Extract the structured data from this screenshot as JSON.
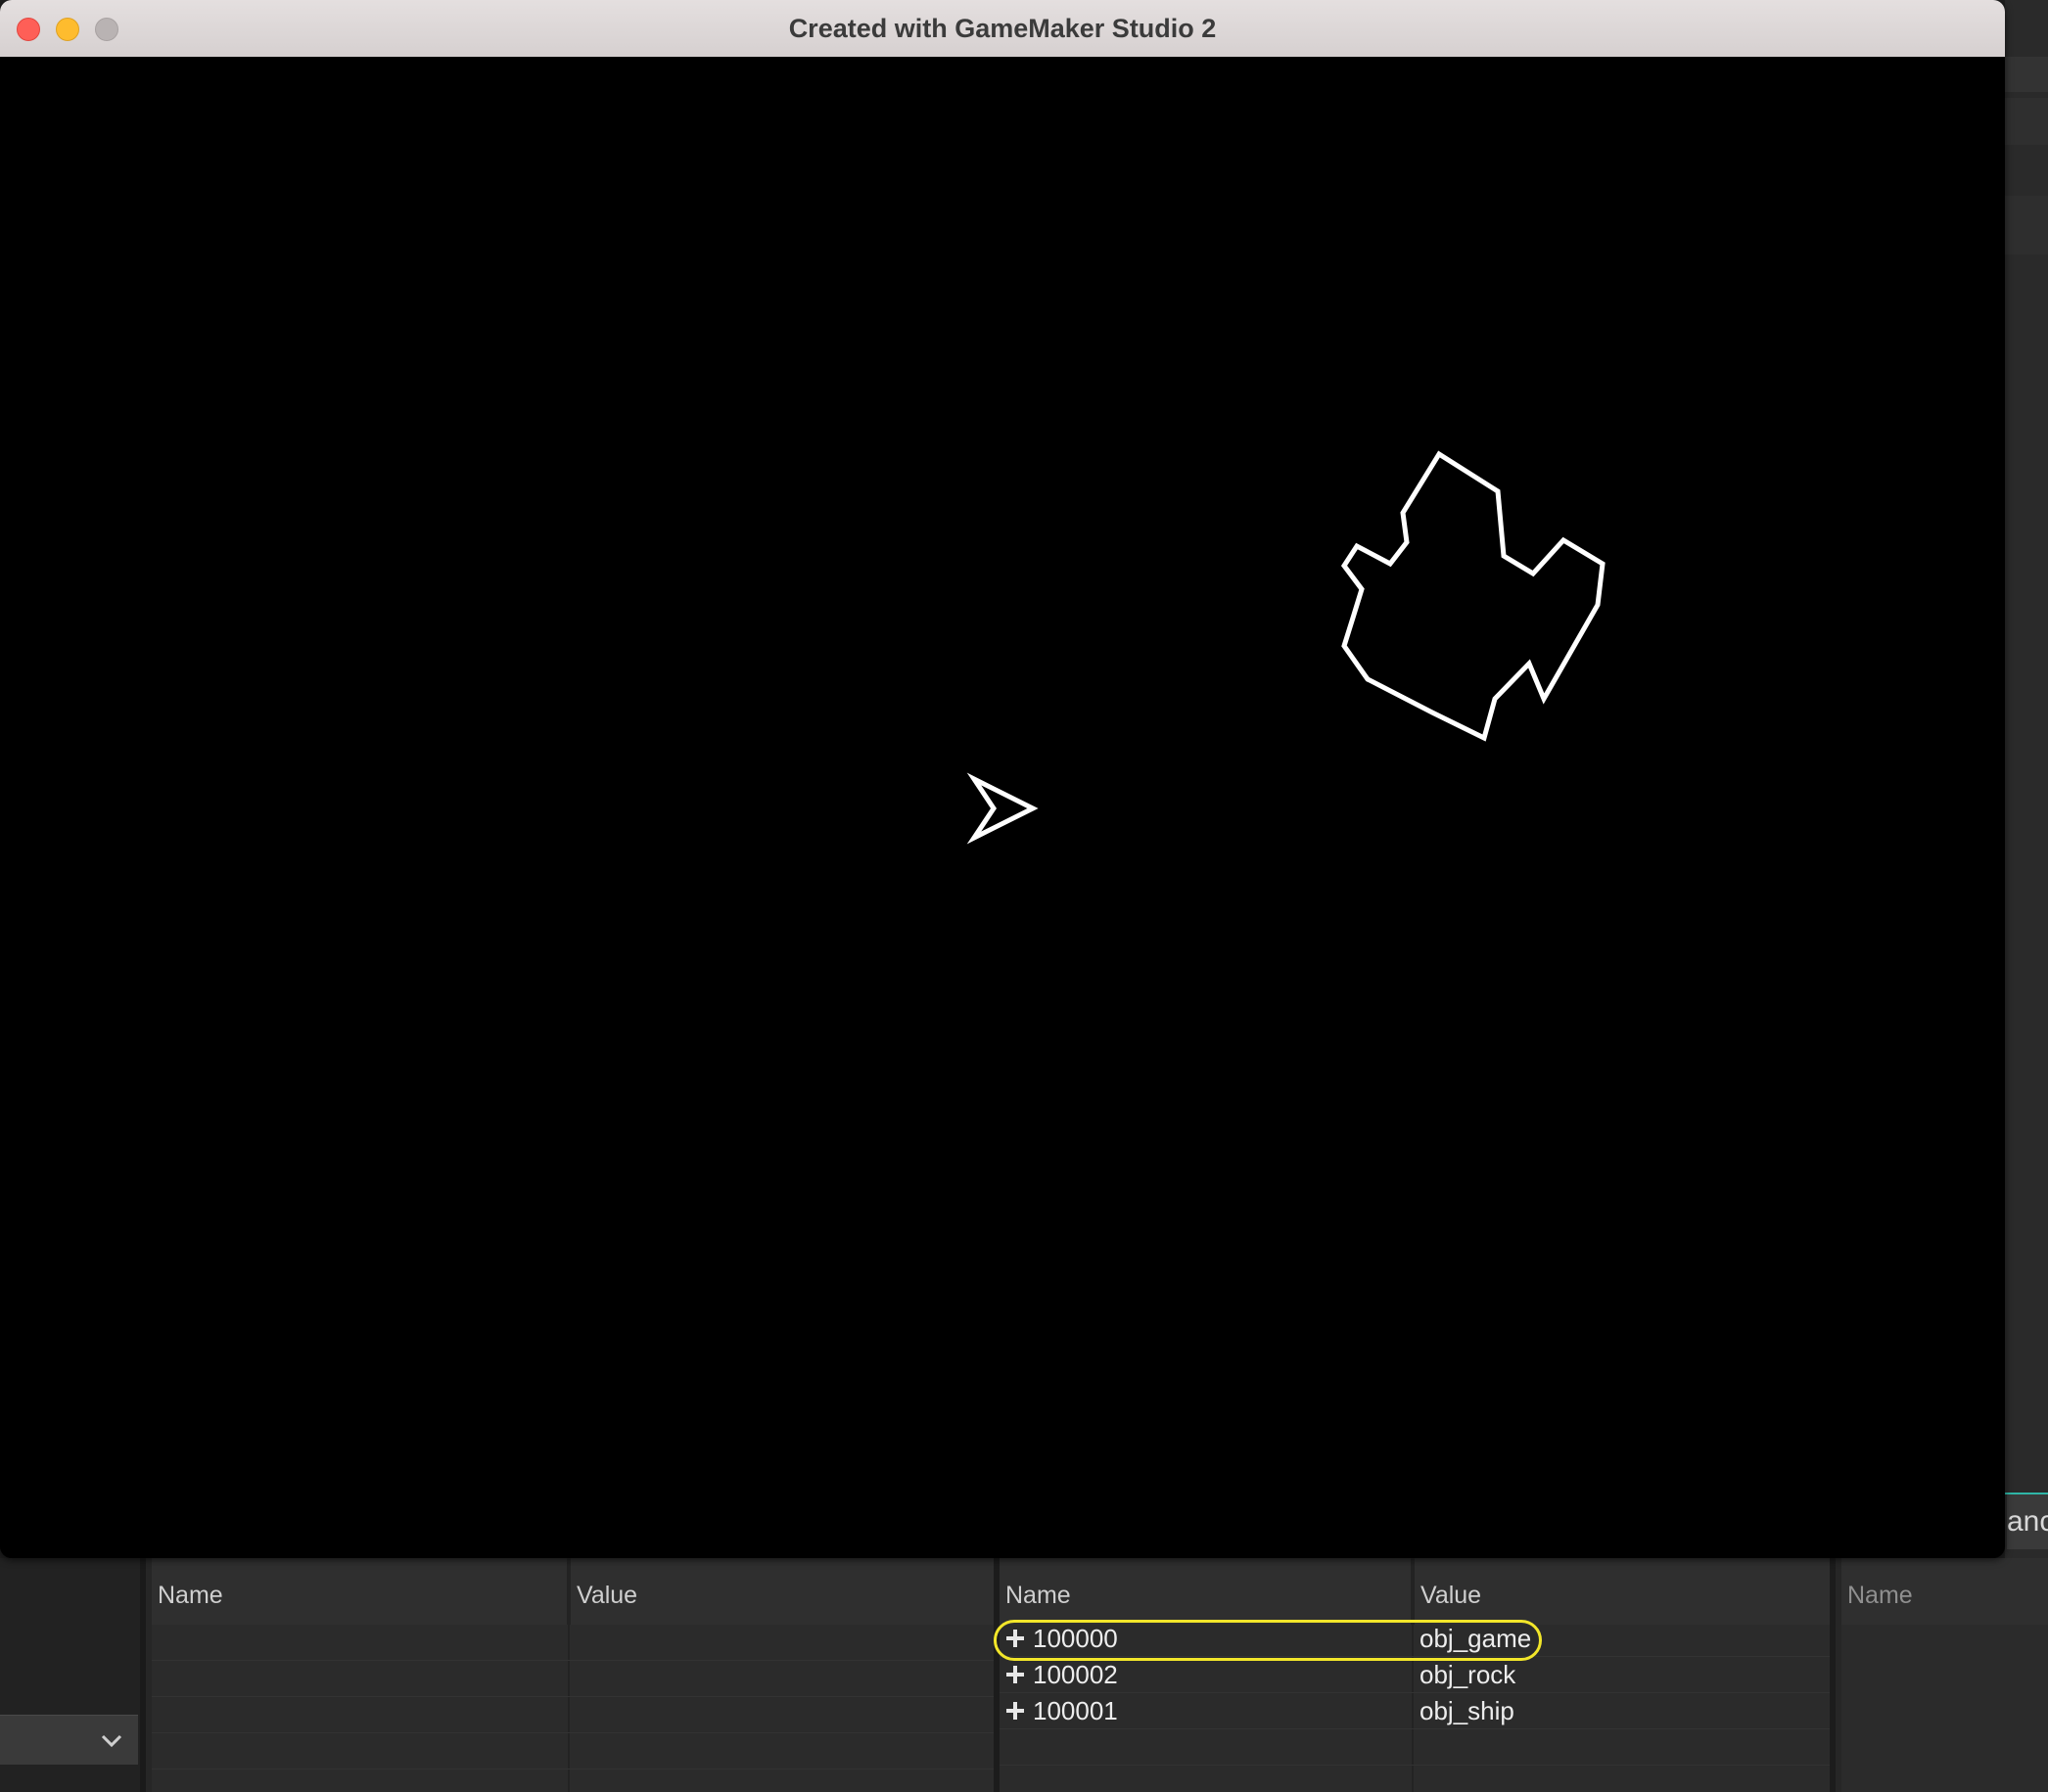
{
  "window": {
    "title": "Created with GameMaker Studio 2",
    "traffic_lights": [
      "close",
      "minimize",
      "maximize"
    ]
  },
  "game": {
    "background": "#000000",
    "sprites": [
      "player-ship",
      "asteroid-rock"
    ]
  },
  "ide_right": {
    "tab_fragment": "ance"
  },
  "debugger": {
    "locals_panel": {
      "columns": [
        "Name",
        "Value"
      ],
      "rows": []
    },
    "instances_panel": {
      "columns": [
        "Name",
        "Value"
      ],
      "rows": [
        {
          "name": "100000",
          "value": "obj_game",
          "highlighted": true
        },
        {
          "name": "100002",
          "value": "obj_rock",
          "highlighted": false
        },
        {
          "name": "100001",
          "value": "obj_ship",
          "highlighted": false
        }
      ]
    },
    "third_panel": {
      "columns": [
        "Name"
      ]
    }
  },
  "colors": {
    "highlight_ring": "#f2e62a",
    "accent_teal": "#2fb6a7"
  }
}
